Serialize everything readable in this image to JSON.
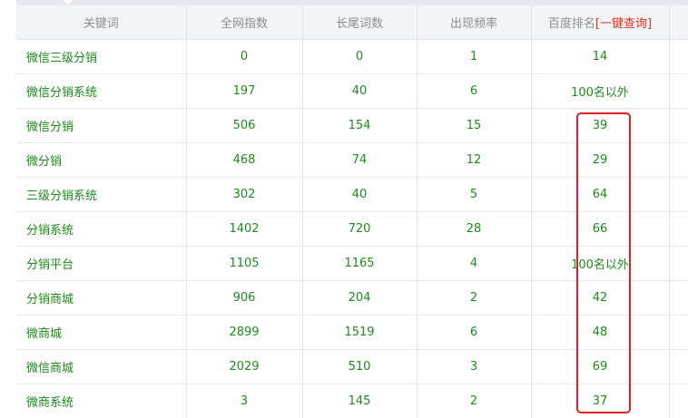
{
  "table": {
    "headers": {
      "keyword": "关键词",
      "index": "全网指数",
      "longtail": "长尾词数",
      "frequency": "出现频率",
      "rank_label": "百度排名",
      "rank_link": "[一键查询]"
    },
    "rows": [
      {
        "keyword": "微信三级分销",
        "index": "0",
        "longtail": "0",
        "frequency": "1",
        "rank": "14"
      },
      {
        "keyword": "微信分销系统",
        "index": "197",
        "longtail": "40",
        "frequency": "6",
        "rank": "100名以外"
      },
      {
        "keyword": "微信分销",
        "index": "506",
        "longtail": "154",
        "frequency": "15",
        "rank": "39"
      },
      {
        "keyword": "微分销",
        "index": "468",
        "longtail": "74",
        "frequency": "12",
        "rank": "29"
      },
      {
        "keyword": "三级分销系统",
        "index": "302",
        "longtail": "40",
        "frequency": "5",
        "rank": "64"
      },
      {
        "keyword": "分销系统",
        "index": "1402",
        "longtail": "720",
        "frequency": "28",
        "rank": "66"
      },
      {
        "keyword": "分销平台",
        "index": "1105",
        "longtail": "1165",
        "frequency": "4",
        "rank": "100名以外"
      },
      {
        "keyword": "分销商城",
        "index": "906",
        "longtail": "204",
        "frequency": "2",
        "rank": "42"
      },
      {
        "keyword": "微商城",
        "index": "2899",
        "longtail": "1519",
        "frequency": "6",
        "rank": "48"
      },
      {
        "keyword": "微信商城",
        "index": "2029",
        "longtail": "510",
        "frequency": "3",
        "rank": "69"
      },
      {
        "keyword": "微商系统",
        "index": "3",
        "longtail": "145",
        "frequency": "2",
        "rank": "37"
      }
    ]
  },
  "colors": {
    "data_text": "#1f8a1f",
    "header_text": "#8a8d93",
    "header_bg": "#f3f4f7",
    "quick_link": "#e0311e",
    "highlight_border": "#e02020"
  }
}
